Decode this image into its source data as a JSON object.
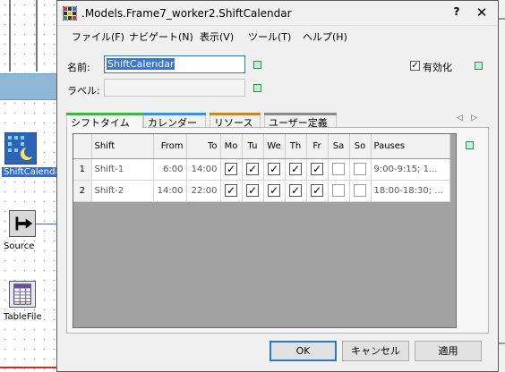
{
  "background": {
    "objects": [
      {
        "label": "ShiftCalenda",
        "icon": "shift-calendar-icon"
      },
      {
        "label": "Source",
        "icon": "source-icon"
      },
      {
        "label": "TableFile",
        "icon": "tablefile-icon"
      }
    ]
  },
  "dialog": {
    "title": ".Models.Frame7_worker2.ShiftCalendar",
    "help_glyph": "?",
    "close_glyph": "✕",
    "menu": [
      "ファイル(F)",
      "ナビゲート(N)",
      "表示(V)",
      "ツール(T)",
      "ヘルプ(H)"
    ],
    "name_label": "名前:",
    "name_value": "ShiftCalendar",
    "label_label": "ラベル:",
    "label_value": "",
    "active_label": "有効化",
    "active_checked": true,
    "tabs": [
      {
        "label": "シフトタイム",
        "color": "#3cb84a"
      },
      {
        "label": "カレンダー",
        "color": "#3a8fe0"
      },
      {
        "label": "リソース",
        "color": "#c8872a"
      },
      {
        "label": "ユーザー定義",
        "color": "#8a8a8a"
      }
    ],
    "tab_prev": "◁",
    "tab_next": "▷",
    "grid": {
      "columns": [
        "Shift",
        "From",
        "To",
        "Mo",
        "Tu",
        "We",
        "Th",
        "Fr",
        "Sa",
        "So",
        "Pauses"
      ],
      "rows": [
        {
          "num": "1",
          "shift": "Shift-1",
          "from": "6:00",
          "to": "14:00",
          "days": [
            true,
            true,
            true,
            true,
            true,
            false,
            false
          ],
          "pauses": "9:00-9:15; 1..."
        },
        {
          "num": "2",
          "shift": "Shift-2",
          "from": "14:00",
          "to": "22:00",
          "days": [
            true,
            true,
            true,
            true,
            true,
            false,
            false
          ],
          "pauses": "18:00-18:30; ..."
        }
      ]
    },
    "buttons": {
      "ok": "OK",
      "cancel": "キャンセル",
      "apply": "適用"
    }
  }
}
